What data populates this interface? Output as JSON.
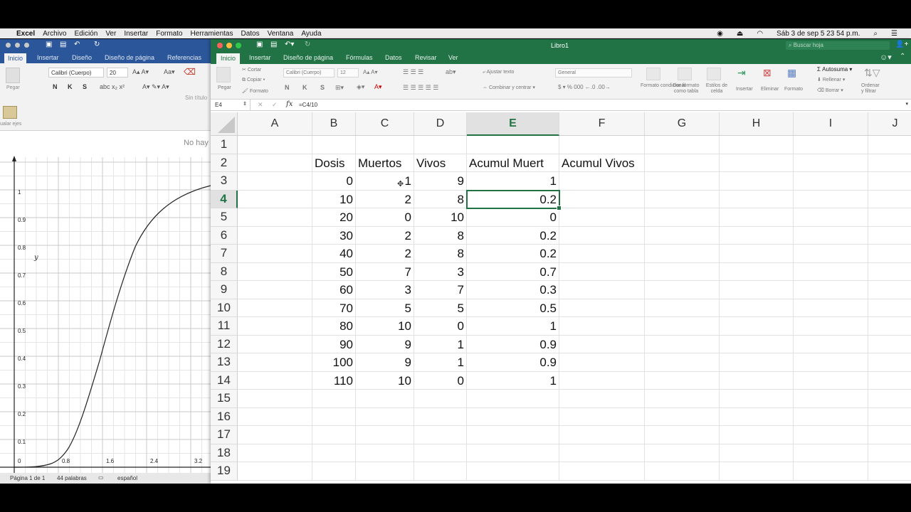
{
  "menubar": {
    "app": "Excel",
    "items": [
      "Archivo",
      "Edición",
      "Ver",
      "Insertar",
      "Formato",
      "Herramientas",
      "Datos",
      "Ventana",
      "Ayuda"
    ],
    "clock": "Sáb 3 de sep  5 23 54 p.m."
  },
  "word": {
    "tabs": [
      "Inicio",
      "Insertar",
      "Diseño",
      "Diseño de página",
      "Referencias"
    ],
    "font": "Calibri (Cuerpo)",
    "size": "20",
    "doc_title": "Sin título",
    "no_hay": "No hay",
    "ajustar_ejes": "ualar ejes",
    "pegar": "Pegar",
    "graph": {
      "y_axis_label": "y",
      "y_ticks": [
        "1",
        "0.9",
        "0.8",
        "0.7",
        "0.6",
        "0.5",
        "0.4",
        "0.3",
        "0.2",
        "0.1"
      ],
      "x_ticks": [
        "0",
        "0.8",
        "1.6",
        "2.4",
        "3.2"
      ]
    },
    "status": {
      "page": "Página 1 de 1",
      "words": "44 palabras",
      "lang": "español"
    }
  },
  "excel": {
    "title": "Libro1",
    "search_placeholder": "Buscar hoja",
    "tabs": [
      "Inicio",
      "Insertar",
      "Diseño de página",
      "Fórmulas",
      "Datos",
      "Revisar",
      "Ver"
    ],
    "ribbon": {
      "pegar": "Pegar",
      "cortar": "Cortar",
      "copiar": "Copiar",
      "formato": "Formato",
      "font": "Calibri (Cuerpo)",
      "size": "12",
      "ajustar_texto": "Ajustar texto",
      "combinar": "Combinar y centrar",
      "number_format": "General",
      "formato_condicional": "Formato condicional",
      "dar_formato": "Dar formato como tabla",
      "estilos": "Estilos de celda",
      "insertar": "Insertar",
      "eliminar": "Eliminar",
      "formato2": "Formato",
      "autosuma": "Autosuma",
      "rellenar": "Rellenar",
      "borrar": "Borrar",
      "ordenar": "Ordenar y filtrar"
    },
    "namebox": "E4",
    "formula": "=C4/10",
    "columns": [
      "A",
      "B",
      "C",
      "D",
      "E",
      "F",
      "G",
      "H",
      "I",
      "J"
    ],
    "rows": [
      "1",
      "2",
      "3",
      "4",
      "5",
      "6",
      "7",
      "8",
      "9",
      "10",
      "11",
      "12",
      "13",
      "14",
      "15",
      "16",
      "17",
      "18",
      "19"
    ],
    "headers": [
      "Dosis",
      "Muertos",
      "Vivos",
      "Acumul Muert",
      "Acumul Vivos"
    ],
    "data": [
      [
        "0",
        "1",
        "9",
        "1"
      ],
      [
        "10",
        "2",
        "8",
        "0.2"
      ],
      [
        "20",
        "0",
        "10",
        "0"
      ],
      [
        "30",
        "2",
        "8",
        "0.2"
      ],
      [
        "40",
        "2",
        "8",
        "0.2"
      ],
      [
        "50",
        "7",
        "3",
        "0.7"
      ],
      [
        "60",
        "3",
        "7",
        "0.3"
      ],
      [
        "70",
        "5",
        "5",
        "0.5"
      ],
      [
        "80",
        "10",
        "0",
        "1"
      ],
      [
        "90",
        "9",
        "1",
        "0.9"
      ],
      [
        "100",
        "9",
        "1",
        "0.9"
      ],
      [
        "110",
        "10",
        "0",
        "1"
      ]
    ]
  }
}
